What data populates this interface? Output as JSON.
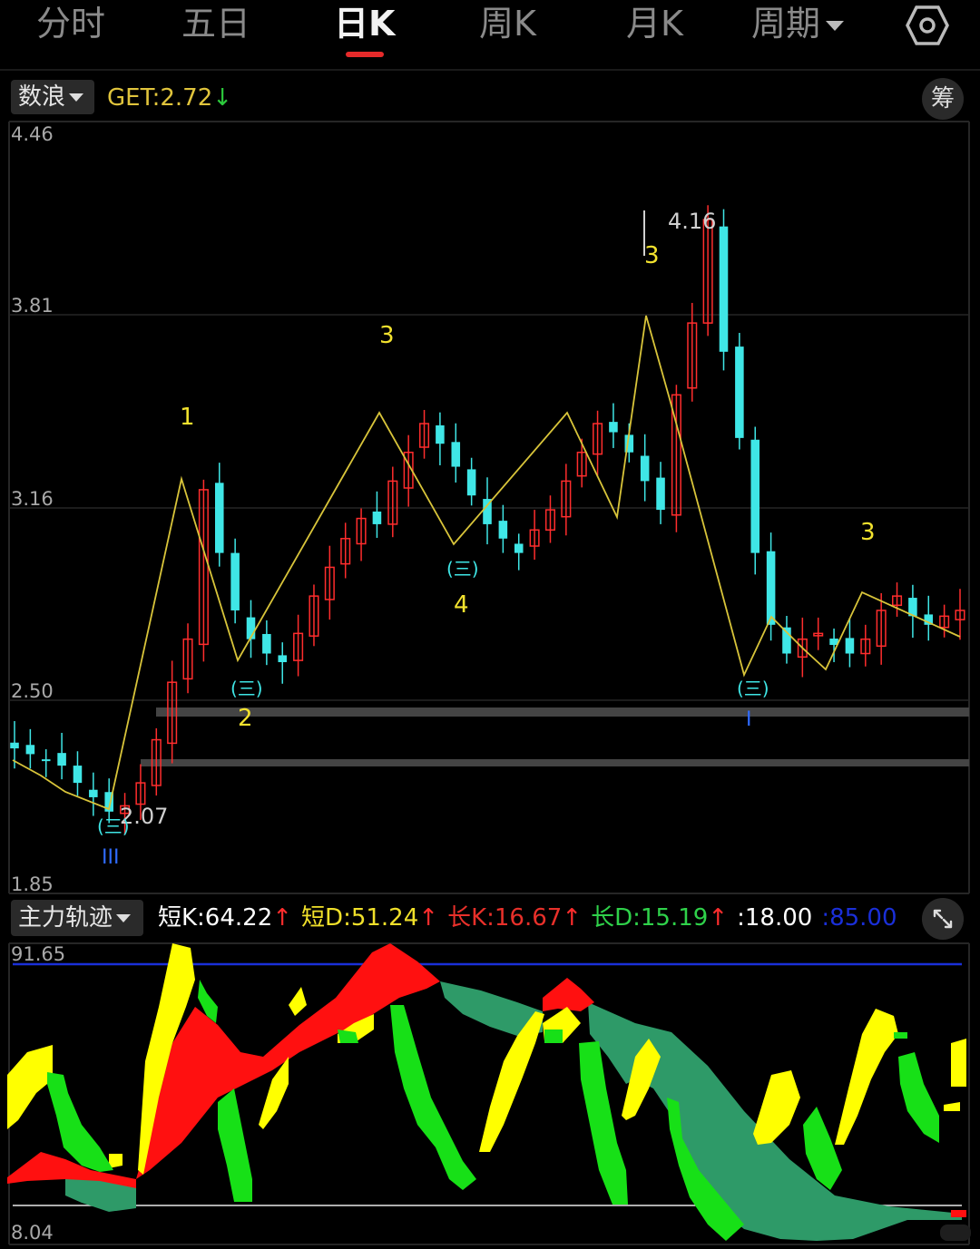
{
  "tabs": [
    {
      "label": "分时",
      "active": false
    },
    {
      "label": "五日",
      "active": false
    },
    {
      "label": "日K",
      "active": true
    },
    {
      "label": "周K",
      "active": false
    },
    {
      "label": "月K",
      "active": false
    },
    {
      "label": "周期",
      "active": false,
      "dropdown": true
    }
  ],
  "settings_icon": "gear-hexagon-icon",
  "main_panel": {
    "indicator_name": "数浪",
    "get_label": "GET:",
    "get_value": "2.72",
    "get_arrow": "↓",
    "chip_button": "筹",
    "y_ticks": [
      "4.46",
      "3.81",
      "3.16",
      "2.50",
      "1.85"
    ],
    "high_label": "4.16",
    "low_label": "2.07",
    "wave_labels": [
      "1",
      "2",
      "3",
      "4",
      "3",
      "3"
    ],
    "circle_labels": [
      "(三)",
      "(三)",
      "(三)",
      "(三)"
    ],
    "roman_labels": [
      "III",
      "I"
    ]
  },
  "sub_panel": {
    "indicator_name": "主力轨迹",
    "values": [
      {
        "label": "短K:",
        "value": "64.22",
        "arrow": "↑",
        "color": "#ffffff"
      },
      {
        "label": "短D:",
        "value": "51.24",
        "arrow": "↑",
        "color": "#f0e02a"
      },
      {
        "label": "长K:",
        "value": "16.67",
        "arrow": "↑",
        "color": "#e8302a"
      },
      {
        "label": "长D:",
        "value": "15.19",
        "arrow": "↑",
        "color": "#2fd14a"
      },
      {
        "label": ":",
        "value": "18.00",
        "arrow": "",
        "color": "#ffffff"
      },
      {
        "label": ":",
        "value": "85.00",
        "arrow": "",
        "color": "#1a2fd8"
      }
    ],
    "y_top": "91.65",
    "y_bottom": "8.04",
    "expand_icon": "expand-arrows-icon"
  },
  "colors": {
    "up": "#ff2d2d",
    "down": "#3fe6e6",
    "wave_line": "#d8c43a",
    "sub_yellow": "#ffff00",
    "sub_red": "#ff1010",
    "sub_green": "#17e017",
    "sub_teal": "#2e9a68"
  },
  "chart_data": {
    "type": "candlestick",
    "y_range": [
      1.85,
      4.46
    ],
    "candles_approx_close": [
      2.32,
      2.3,
      2.28,
      2.26,
      2.2,
      2.15,
      2.1,
      2.12,
      2.2,
      2.35,
      2.55,
      2.7,
      3.22,
      3.0,
      2.8,
      2.7,
      2.65,
      2.62,
      2.72,
      2.85,
      2.95,
      3.05,
      3.12,
      3.1,
      3.25,
      3.35,
      3.45,
      3.38,
      3.3,
      3.2,
      3.1,
      3.05,
      3.0,
      3.08,
      3.15,
      3.25,
      3.35,
      3.45,
      3.42,
      3.35,
      3.25,
      3.15,
      3.55,
      3.8,
      4.16,
      3.7,
      3.4,
      3.0,
      2.75,
      2.65,
      2.7,
      2.72,
      2.68,
      2.65,
      2.7,
      2.8,
      2.85,
      2.78,
      2.75,
      2.78,
      2.8
    ],
    "reference_lines": [
      2.47,
      2.28
    ]
  }
}
